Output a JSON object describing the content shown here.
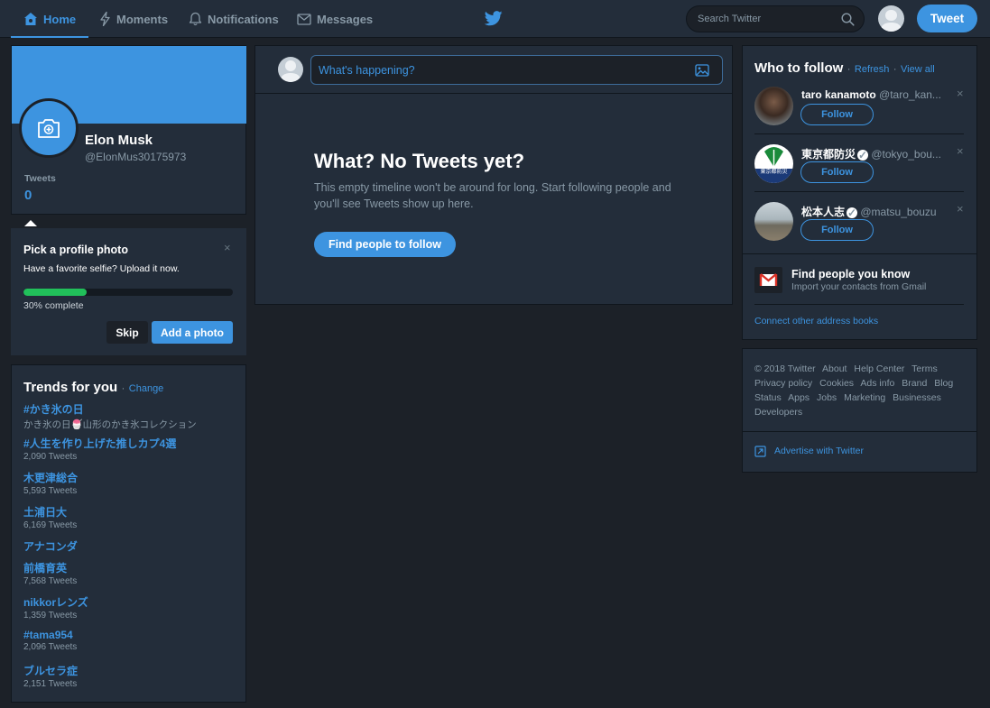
{
  "nav": {
    "home": "Home",
    "moments": "Moments",
    "notifications": "Notifications",
    "messages": "Messages",
    "search_placeholder": "Search Twitter",
    "tweet_button": "Tweet"
  },
  "profile": {
    "name": "Elon Musk",
    "handle": "@ElonMus30175973",
    "tweets_label": "Tweets",
    "tweets_count": "0"
  },
  "profile_photo_prompt": {
    "title": "Pick a profile photo",
    "subtitle": "Have a favorite selfie? Upload it now.",
    "progress_fraction": 0.3,
    "progress_text": "30% complete",
    "skip_label": "Skip",
    "add_label": "Add a photo",
    "close": "×"
  },
  "trends": {
    "title": "Trends for you",
    "separator": "·",
    "change_label": "Change",
    "items": [
      {
        "name": "#かき氷の日",
        "sub": "かき氷の日🍧山形のかき氷コレクション"
      },
      {
        "name": "#人生を作り上げた推しカプ4選",
        "sub": "2,090 Tweets"
      },
      {
        "name": "木更津総合",
        "sub": "5,593 Tweets"
      },
      {
        "name": "土浦日大",
        "sub": "6,169 Tweets"
      },
      {
        "name": "アナコンダ",
        "sub": ""
      },
      {
        "name": "前橋育英",
        "sub": "7,568 Tweets"
      },
      {
        "name": "nikkorレンズ",
        "sub": "1,359 Tweets"
      },
      {
        "name": "#tama954",
        "sub": "2,096 Tweets"
      },
      {
        "name": "ブルセラ症",
        "sub": "2,151 Tweets"
      }
    ]
  },
  "composer": {
    "placeholder": "What's happening?"
  },
  "empty_timeline": {
    "title": "What? No Tweets yet?",
    "body": "This empty timeline won't be around for long. Start following people and you'll see Tweets show up here.",
    "button": "Find people to follow"
  },
  "who_to_follow": {
    "title": "Who to follow",
    "separator": "·",
    "refresh": "Refresh",
    "view_all": "View all",
    "follow_label": "Follow",
    "close": "×",
    "accounts": [
      {
        "name": "taro kanamoto",
        "handle": "@taro_kan...",
        "verified": false
      },
      {
        "name": "東京都防災",
        "handle": "@tokyo_bou...",
        "verified": true,
        "avatar_text": "東京都防災"
      },
      {
        "name": "松本人志",
        "handle": "@matsu_bouzu",
        "verified": true
      }
    ],
    "find_title": "Find people you know",
    "find_sub": "Import your contacts from Gmail",
    "connect": "Connect other address books"
  },
  "footer": {
    "links": [
      "© 2018 Twitter",
      "About",
      "Help Center",
      "Terms",
      "Privacy policy",
      "Cookies",
      "Ads info",
      "Brand",
      "Blog",
      "Status",
      "Apps",
      "Jobs",
      "Marketing",
      "Businesses",
      "Developers"
    ],
    "advertise": "Advertise with Twitter"
  },
  "colors": {
    "accent": "#3d94e0",
    "background": "#1c2128",
    "card": "#232d3a",
    "progress": "#21c05a"
  }
}
